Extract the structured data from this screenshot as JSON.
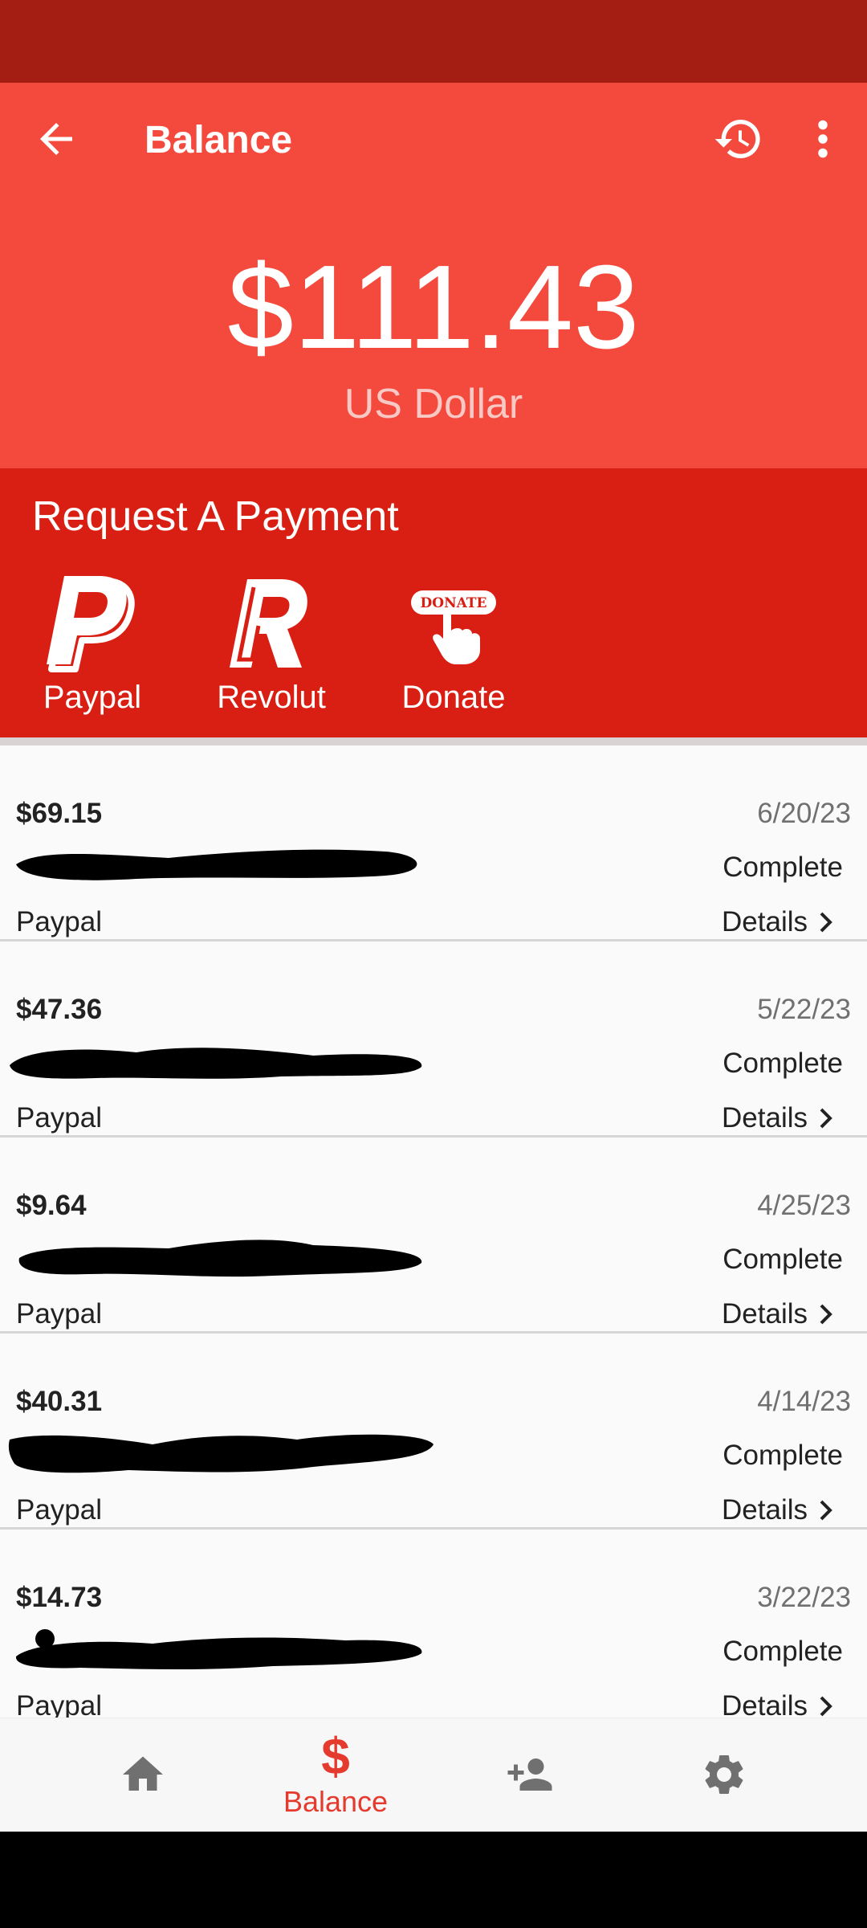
{
  "header": {
    "title": "Balance",
    "balance": "$111.43",
    "currency": "US Dollar"
  },
  "request": {
    "heading": "Request A Payment",
    "options": [
      {
        "label": "Paypal",
        "icon": "paypal-icon"
      },
      {
        "label": "Revolut",
        "icon": "revolut-icon"
      },
      {
        "label": "Donate",
        "icon": "donate-icon",
        "badge": "DONATE"
      }
    ]
  },
  "transactions": [
    {
      "amount": "$69.15",
      "date": "6/20/23",
      "status": "Complete",
      "method": "Paypal",
      "details": "Details"
    },
    {
      "amount": "$47.36",
      "date": "5/22/23",
      "status": "Complete",
      "method": "Paypal",
      "details": "Details"
    },
    {
      "amount": "$9.64",
      "date": "4/25/23",
      "status": "Complete",
      "method": "Paypal",
      "details": "Details"
    },
    {
      "amount": "$40.31",
      "date": "4/14/23",
      "status": "Complete",
      "method": "Paypal",
      "details": "Details"
    },
    {
      "amount": "$14.73",
      "date": "3/22/23",
      "status": "Complete",
      "method": "Paypal",
      "details": "Details"
    }
  ],
  "bottom_nav": {
    "items": [
      {
        "icon": "home-icon"
      },
      {
        "icon": "dollar-icon",
        "glyph": "$",
        "label": "Balance",
        "active": true
      },
      {
        "icon": "add-user-icon"
      },
      {
        "icon": "gear-icon"
      }
    ]
  },
  "colors": {
    "status_bar": "#A51E14",
    "app_bar": "#F44A3D",
    "request_bg": "#D91F13",
    "accent": "#E53A2E"
  }
}
